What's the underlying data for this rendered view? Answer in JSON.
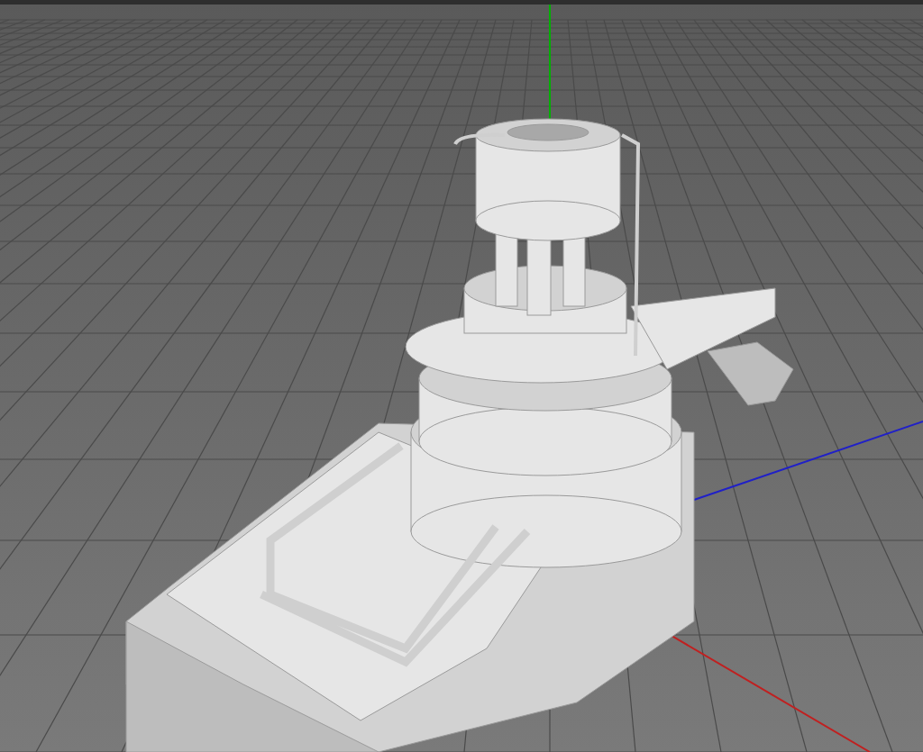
{
  "viewport": {
    "grid": true,
    "axes": [
      {
        "kind": "y",
        "color": "#00b000"
      },
      {
        "kind": "z",
        "color": "#2020c8"
      },
      {
        "kind": "x",
        "color": "#c02020"
      }
    ]
  }
}
